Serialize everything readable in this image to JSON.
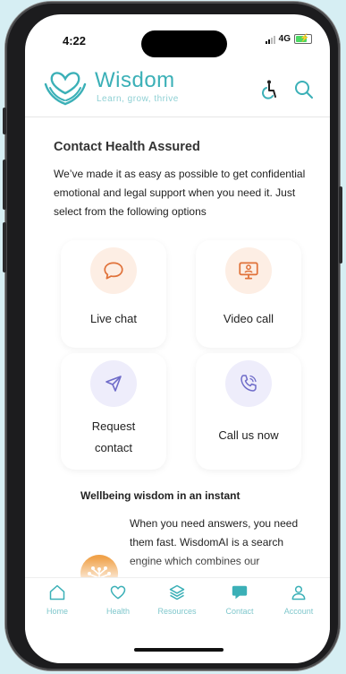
{
  "status": {
    "time": "4:22",
    "network": "4G"
  },
  "header": {
    "brand": "Wisdom",
    "tagline": "Learn, grow, thrive",
    "icons": {
      "accessibility": "accessibility-icon",
      "search": "search-icon"
    }
  },
  "contact": {
    "title": "Contact Health Assured",
    "description": "We’ve made it as easy as possible to get confidential emotional and legal support when you need it. Just select from the following options",
    "options": [
      {
        "label": "Live chat",
        "icon": "chat-bubble-icon",
        "color": "#e0723a"
      },
      {
        "label": "Video call",
        "icon": "monitor-user-icon",
        "color": "#e0723a"
      },
      {
        "label_line1": "Request",
        "label_line2": "contact",
        "icon": "send-icon",
        "color": "#6f6cc9"
      },
      {
        "label": "Call us now",
        "icon": "phone-icon",
        "color": "#6f6cc9"
      }
    ]
  },
  "wellbeing": {
    "title": "Wellbeing wisdom in an instant",
    "text": "When you need answers, you need them fast. WisdomAI is a search engine which combines our"
  },
  "nav": [
    {
      "label": "Home",
      "icon": "home-icon",
      "active": false
    },
    {
      "label": "Health",
      "icon": "heart-icon",
      "active": false
    },
    {
      "label": "Resources",
      "icon": "layers-icon",
      "active": false
    },
    {
      "label": "Contact",
      "icon": "contact-icon",
      "active": true
    },
    {
      "label": "Account",
      "icon": "user-icon",
      "active": false
    }
  ],
  "colors": {
    "brand": "#3bb0b7",
    "orange_tint": "#fdeee4",
    "purple_tint": "#eeedfb",
    "background": "#d6eef3"
  }
}
